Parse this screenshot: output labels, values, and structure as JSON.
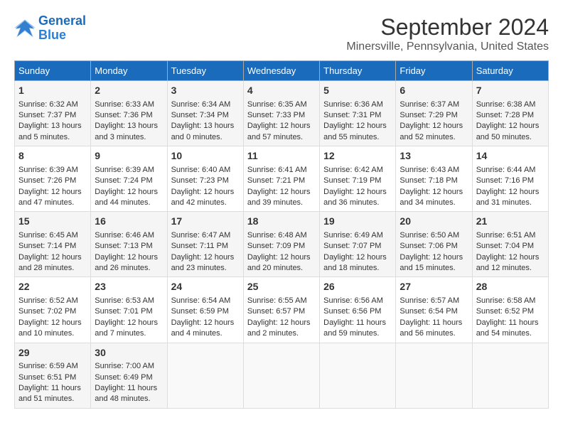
{
  "logo": {
    "line1": "General",
    "line2": "Blue"
  },
  "title": "September 2024",
  "subtitle": "Minersville, Pennsylvania, United States",
  "days_of_week": [
    "Sunday",
    "Monday",
    "Tuesday",
    "Wednesday",
    "Thursday",
    "Friday",
    "Saturday"
  ],
  "weeks": [
    [
      {
        "day": "1",
        "sunrise": "6:32 AM",
        "sunset": "7:37 PM",
        "daylight": "13 hours and 5 minutes."
      },
      {
        "day": "2",
        "sunrise": "6:33 AM",
        "sunset": "7:36 PM",
        "daylight": "13 hours and 3 minutes."
      },
      {
        "day": "3",
        "sunrise": "6:34 AM",
        "sunset": "7:34 PM",
        "daylight": "13 hours and 0 minutes."
      },
      {
        "day": "4",
        "sunrise": "6:35 AM",
        "sunset": "7:33 PM",
        "daylight": "12 hours and 57 minutes."
      },
      {
        "day": "5",
        "sunrise": "6:36 AM",
        "sunset": "7:31 PM",
        "daylight": "12 hours and 55 minutes."
      },
      {
        "day": "6",
        "sunrise": "6:37 AM",
        "sunset": "7:29 PM",
        "daylight": "12 hours and 52 minutes."
      },
      {
        "day": "7",
        "sunrise": "6:38 AM",
        "sunset": "7:28 PM",
        "daylight": "12 hours and 50 minutes."
      }
    ],
    [
      {
        "day": "8",
        "sunrise": "6:39 AM",
        "sunset": "7:26 PM",
        "daylight": "12 hours and 47 minutes."
      },
      {
        "day": "9",
        "sunrise": "6:39 AM",
        "sunset": "7:24 PM",
        "daylight": "12 hours and 44 minutes."
      },
      {
        "day": "10",
        "sunrise": "6:40 AM",
        "sunset": "7:23 PM",
        "daylight": "12 hours and 42 minutes."
      },
      {
        "day": "11",
        "sunrise": "6:41 AM",
        "sunset": "7:21 PM",
        "daylight": "12 hours and 39 minutes."
      },
      {
        "day": "12",
        "sunrise": "6:42 AM",
        "sunset": "7:19 PM",
        "daylight": "12 hours and 36 minutes."
      },
      {
        "day": "13",
        "sunrise": "6:43 AM",
        "sunset": "7:18 PM",
        "daylight": "12 hours and 34 minutes."
      },
      {
        "day": "14",
        "sunrise": "6:44 AM",
        "sunset": "7:16 PM",
        "daylight": "12 hours and 31 minutes."
      }
    ],
    [
      {
        "day": "15",
        "sunrise": "6:45 AM",
        "sunset": "7:14 PM",
        "daylight": "12 hours and 28 minutes."
      },
      {
        "day": "16",
        "sunrise": "6:46 AM",
        "sunset": "7:13 PM",
        "daylight": "12 hours and 26 minutes."
      },
      {
        "day": "17",
        "sunrise": "6:47 AM",
        "sunset": "7:11 PM",
        "daylight": "12 hours and 23 minutes."
      },
      {
        "day": "18",
        "sunrise": "6:48 AM",
        "sunset": "7:09 PM",
        "daylight": "12 hours and 20 minutes."
      },
      {
        "day": "19",
        "sunrise": "6:49 AM",
        "sunset": "7:07 PM",
        "daylight": "12 hours and 18 minutes."
      },
      {
        "day": "20",
        "sunrise": "6:50 AM",
        "sunset": "7:06 PM",
        "daylight": "12 hours and 15 minutes."
      },
      {
        "day": "21",
        "sunrise": "6:51 AM",
        "sunset": "7:04 PM",
        "daylight": "12 hours and 12 minutes."
      }
    ],
    [
      {
        "day": "22",
        "sunrise": "6:52 AM",
        "sunset": "7:02 PM",
        "daylight": "12 hours and 10 minutes."
      },
      {
        "day": "23",
        "sunrise": "6:53 AM",
        "sunset": "7:01 PM",
        "daylight": "12 hours and 7 minutes."
      },
      {
        "day": "24",
        "sunrise": "6:54 AM",
        "sunset": "6:59 PM",
        "daylight": "12 hours and 4 minutes."
      },
      {
        "day": "25",
        "sunrise": "6:55 AM",
        "sunset": "6:57 PM",
        "daylight": "12 hours and 2 minutes."
      },
      {
        "day": "26",
        "sunrise": "6:56 AM",
        "sunset": "6:56 PM",
        "daylight": "11 hours and 59 minutes."
      },
      {
        "day": "27",
        "sunrise": "6:57 AM",
        "sunset": "6:54 PM",
        "daylight": "11 hours and 56 minutes."
      },
      {
        "day": "28",
        "sunrise": "6:58 AM",
        "sunset": "6:52 PM",
        "daylight": "11 hours and 54 minutes."
      }
    ],
    [
      {
        "day": "29",
        "sunrise": "6:59 AM",
        "sunset": "6:51 PM",
        "daylight": "11 hours and 51 minutes."
      },
      {
        "day": "30",
        "sunrise": "7:00 AM",
        "sunset": "6:49 PM",
        "daylight": "11 hours and 48 minutes."
      },
      null,
      null,
      null,
      null,
      null
    ]
  ],
  "labels": {
    "sunrise": "Sunrise: ",
    "sunset": "Sunset: ",
    "daylight": "Daylight: "
  }
}
